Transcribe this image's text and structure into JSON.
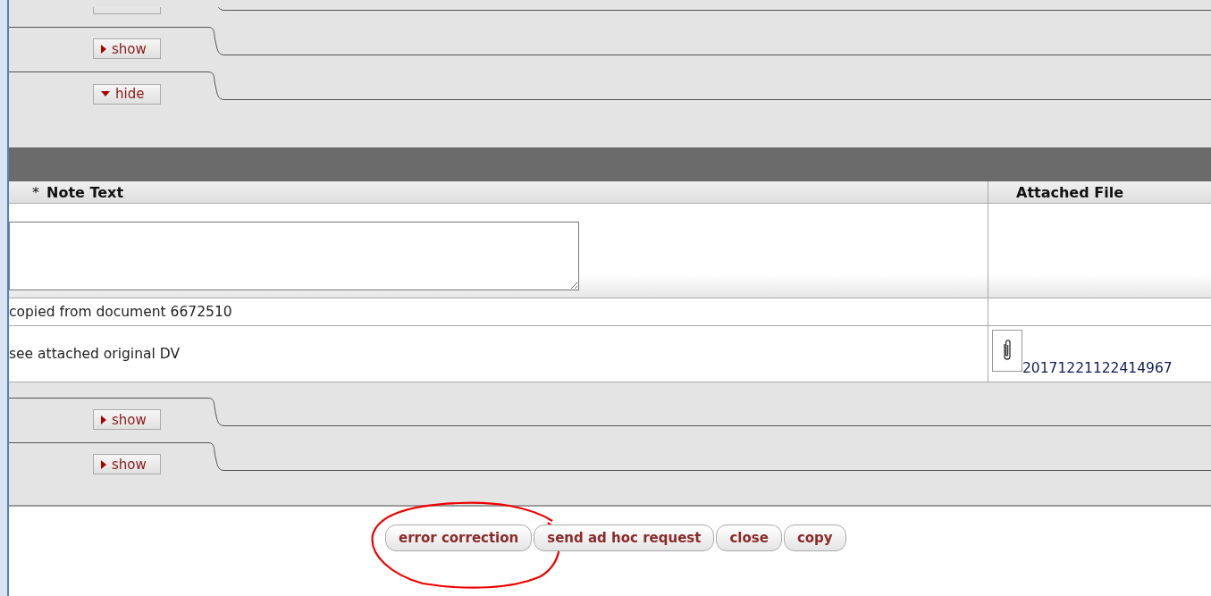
{
  "sections_top": [
    {
      "label": "show",
      "expanded": false
    },
    {
      "label": "hide",
      "expanded": true
    }
  ],
  "notes_table": {
    "columns": [
      {
        "marker": "*",
        "label": "Note Text"
      },
      {
        "label": "Attached File"
      }
    ],
    "rows": [
      {
        "note": "copied from document 6672510"
      },
      {
        "note": "see attached original DV",
        "attachment": "20171221122414967"
      }
    ]
  },
  "sections_bottom": [
    {
      "label": "show",
      "expanded": false
    },
    {
      "label": "show",
      "expanded": false
    }
  ],
  "actions": [
    {
      "label": "error correction",
      "annotated": true
    },
    {
      "label": "send ad hoc request",
      "annotated": false
    },
    {
      "label": "close",
      "annotated": false
    },
    {
      "label": "copy",
      "annotated": false
    }
  ]
}
